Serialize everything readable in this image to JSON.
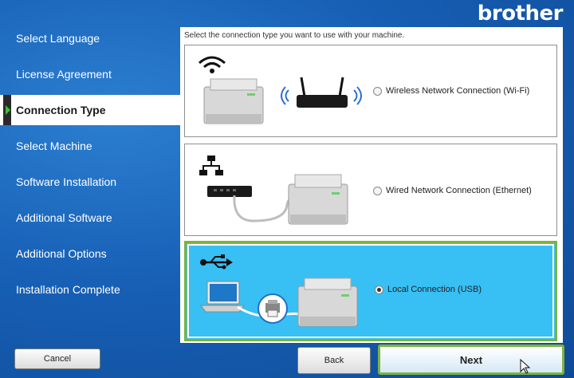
{
  "brand": {
    "logo_text": "brother"
  },
  "sidebar": {
    "steps": [
      {
        "label": "Select Language"
      },
      {
        "label": "License Agreement"
      },
      {
        "label": "Connection Type"
      },
      {
        "label": "Select Machine"
      },
      {
        "label": "Software Installation"
      },
      {
        "label": "Additional Software"
      },
      {
        "label": "Additional Options"
      },
      {
        "label": "Installation Complete"
      }
    ],
    "active_step": "Connection Type"
  },
  "main": {
    "instruction": "Select the connection type you want to use with your machine.",
    "options": [
      {
        "label": "Wireless Network Connection (Wi-Fi)",
        "selected": false,
        "icon": "wifi-icon"
      },
      {
        "label": "Wired Network Connection (Ethernet)",
        "selected": false,
        "icon": "network-icon"
      },
      {
        "label": "Local Connection (USB)",
        "selected": true,
        "icon": "usb-icon"
      }
    ]
  },
  "buttons": {
    "cancel": "Cancel",
    "back": "Back",
    "next": "Next"
  },
  "colors": {
    "selected_bg": "#38bff3",
    "highlight_border": "#7cb33e",
    "page_bg": "#1760b6"
  }
}
